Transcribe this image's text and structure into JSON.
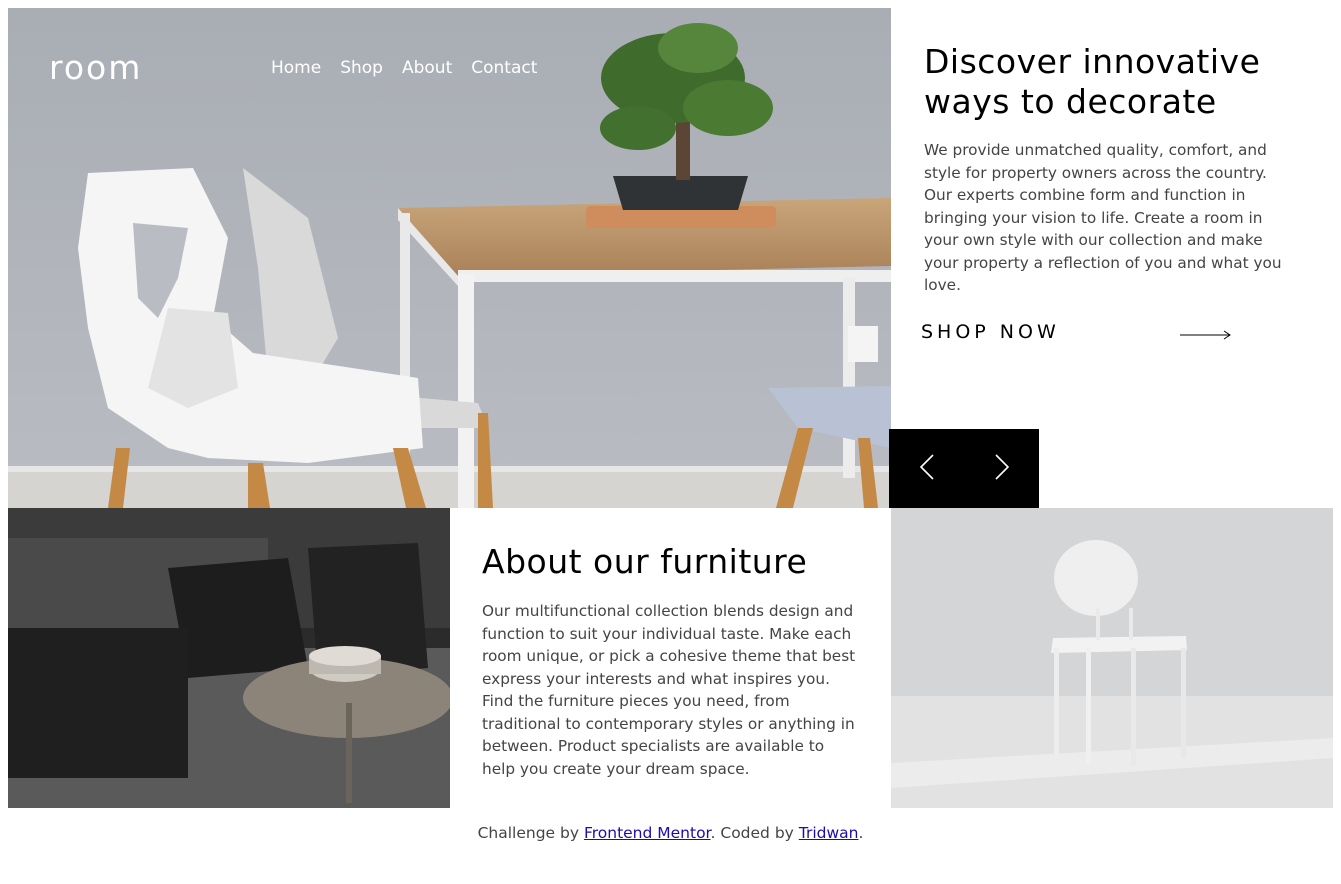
{
  "nav": {
    "logo": "room",
    "links": [
      "Home",
      "Shop",
      "About",
      "Contact"
    ]
  },
  "hero": {
    "title": "Discover innovative ways to decorate",
    "body": "We provide unmatched quality, comfort, and style for property owners across the country. Our experts combine form and function in bringing your vision to life. Create a room in your own style with our collection and make your property a reflection of you and what you love.",
    "cta_label": "SHOP NOW",
    "cta_icon": "arrow-right-icon",
    "prev_icon": "chevron-left-icon",
    "next_icon": "chevron-right-icon"
  },
  "about": {
    "title": "About our furniture",
    "body": "Our multifunctional collection blends design and function to suit your individual taste. Make each room unique, or pick a cohesive theme that best express your interests and what inspires you. Find the furniture pieces you need, from traditional to contemporary styles or anything in between. Product specialists are available to help you create your dream space."
  },
  "footer": {
    "prefix": "Challenge by ",
    "link1": "Frontend Mentor",
    "middle": ". Coded by ",
    "link2": "Tridwan",
    "suffix": "."
  },
  "colors": {
    "control_bg": "#000000",
    "link": "#1a0dab",
    "body_text": "#444444"
  }
}
